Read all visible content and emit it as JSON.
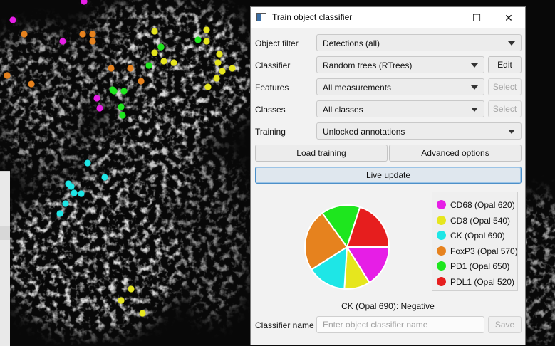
{
  "dialog": {
    "title": "Train object classifier",
    "window_controls": {
      "minimize": "—",
      "maximize": "☐",
      "close": "✕"
    }
  },
  "form": {
    "object_filter": {
      "label": "Object filter",
      "value": "Detections (all)"
    },
    "classifier": {
      "label": "Classifier",
      "value": "Random trees (RTrees)",
      "button": "Edit"
    },
    "features": {
      "label": "Features",
      "value": "All measurements",
      "button": "Select"
    },
    "classes": {
      "label": "Classes",
      "value": "All classes",
      "button": "Select"
    },
    "training": {
      "label": "Training",
      "value": "Unlocked annotations"
    }
  },
  "buttons": {
    "load_training": "Load training",
    "advanced_options": "Advanced options",
    "live_update": "Live update",
    "save": "Save"
  },
  "chart_data": {
    "type": "pie",
    "title": "",
    "slices": [
      {
        "label": "CD68 (Opal 620)",
        "value": 16,
        "color": "#e61ee6"
      },
      {
        "label": "CD8 (Opal 540)",
        "value": 10,
        "color": "#e6e61e"
      },
      {
        "label": "CK (Opal 690)",
        "value": 15,
        "color": "#1ee6e6"
      },
      {
        "label": "FoxP3 (Opal 570)",
        "value": 24,
        "color": "#e6821e"
      },
      {
        "label": "PD1 (Opal 650)",
        "value": 15,
        "color": "#1ee61e"
      },
      {
        "label": "PDL1 (Opal 520)",
        "value": 20,
        "color": "#e61e1e"
      }
    ]
  },
  "hover_status": "CK (Opal 690): Negative",
  "classifier_name": {
    "label": "Classifier name",
    "placeholder": "Enter object classifier name",
    "value": ""
  },
  "background_points": {
    "CD68": {
      "color": "#e61ee6",
      "count": 5
    },
    "CD8": {
      "color": "#e6e61e",
      "count": 16
    },
    "CK": {
      "color": "#1ee6e6",
      "count": 8
    },
    "FoxP3": {
      "color": "#e6821e",
      "count": 9
    },
    "PD1": {
      "color": "#1ee61e",
      "count": 9
    },
    "PDL1": {
      "color": "#e61e1e",
      "count": 0
    }
  }
}
